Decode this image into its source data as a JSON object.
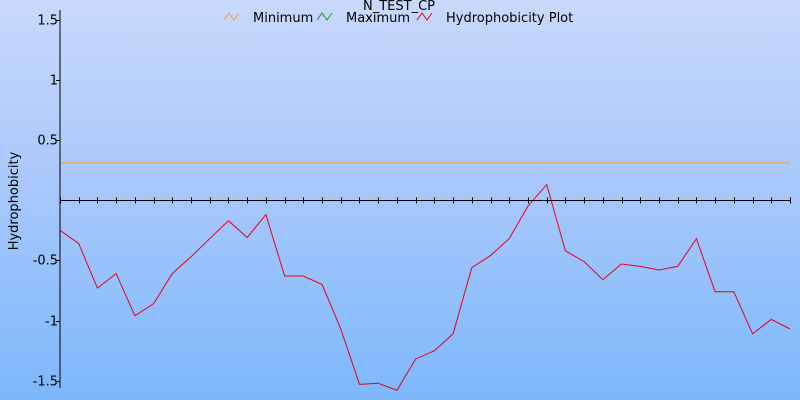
{
  "chart_data": {
    "type": "line",
    "title": "N_TEST_CP",
    "ylabel": "Hydrophobicity",
    "xlabel": "",
    "ylim": [
      -1.56,
      1.58
    ],
    "xlim": [
      1,
      40
    ],
    "yticks": [
      -1.5,
      -1,
      -0.5,
      0.5,
      1,
      1.5
    ],
    "ytick_labels": [
      "-1.5",
      "-1",
      "-0.5",
      "0.5",
      "1",
      "1.5"
    ],
    "grid": false,
    "legend_position": "top",
    "series": [
      {
        "name": "Minimum",
        "color": "#f0a030",
        "x": [
          1,
          40
        ],
        "y": [
          0.31,
          0.31
        ]
      },
      {
        "name": "Maximum",
        "color": "#1a9a1a",
        "x": [],
        "y": []
      },
      {
        "name": "Hydrophobicity Plot",
        "color": "#e8001c",
        "x": [
          1,
          2,
          3,
          4,
          5,
          6,
          7,
          8,
          9,
          10,
          11,
          12,
          13,
          14,
          15,
          16,
          17,
          18,
          19,
          20,
          21,
          22,
          23,
          24,
          25,
          26,
          27,
          28,
          29,
          30,
          31,
          32,
          33,
          34,
          35,
          36,
          37,
          38,
          39,
          40
        ],
        "y": [
          -0.25,
          -0.36,
          -0.73,
          -0.61,
          -0.96,
          -0.86,
          -0.61,
          -0.47,
          -0.32,
          -0.17,
          -0.31,
          -0.12,
          -0.63,
          -0.63,
          -0.7,
          -1.07,
          -1.53,
          -1.52,
          -1.58,
          -1.32,
          -1.25,
          -1.11,
          -0.56,
          -0.46,
          -0.32,
          -0.05,
          0.13,
          -0.42,
          -0.51,
          -0.66,
          -0.53,
          -0.55,
          -0.58,
          -0.55,
          -0.32,
          -0.76,
          -0.76,
          -1.11,
          -0.99,
          -1.07
        ]
      }
    ]
  }
}
